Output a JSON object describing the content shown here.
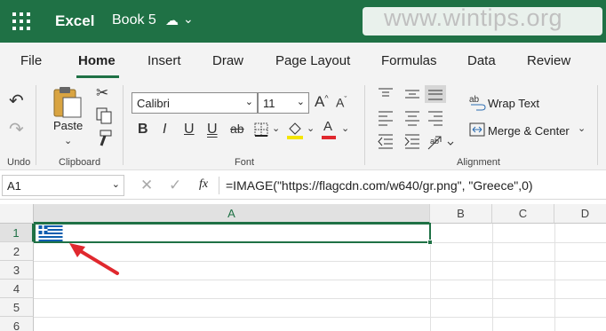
{
  "titlebar": {
    "app_name": "Excel",
    "book_name": "Book 5",
    "book_status_icon": "saved-cloud-icon",
    "watermark": "www.wintips.org"
  },
  "tabs": [
    {
      "label": "File"
    },
    {
      "label": "Home",
      "active": true
    },
    {
      "label": "Insert"
    },
    {
      "label": "Draw"
    },
    {
      "label": "Page Layout"
    },
    {
      "label": "Formulas"
    },
    {
      "label": "Data"
    },
    {
      "label": "Review"
    }
  ],
  "ribbon": {
    "undo": {
      "group_label": "Undo"
    },
    "clipboard": {
      "paste_label": "Paste",
      "group_label": "Clipboard"
    },
    "font": {
      "font_name": "Calibri",
      "font_size": "11",
      "group_label": "Font"
    },
    "alignment": {
      "wrap_text": "Wrap Text",
      "merge_center": "Merge & Center",
      "group_label": "Alignment"
    }
  },
  "formula_bar": {
    "name_box": "A1",
    "fx": "fx",
    "formula": "=IMAGE(\"https://flagcdn.com/w640/gr.png\", \"Greece\",0)"
  },
  "grid": {
    "columns": [
      "A",
      "B",
      "C",
      "D"
    ],
    "rows": [
      "1",
      "2",
      "3",
      "4",
      "5",
      "6"
    ],
    "selected_cell": "A1",
    "cell_image": "greece-flag"
  },
  "colors": {
    "brand": "#1f7145",
    "annotation_arrow": "#e0282e",
    "highlight": "#f4e500",
    "font_color": "#e0282e"
  }
}
